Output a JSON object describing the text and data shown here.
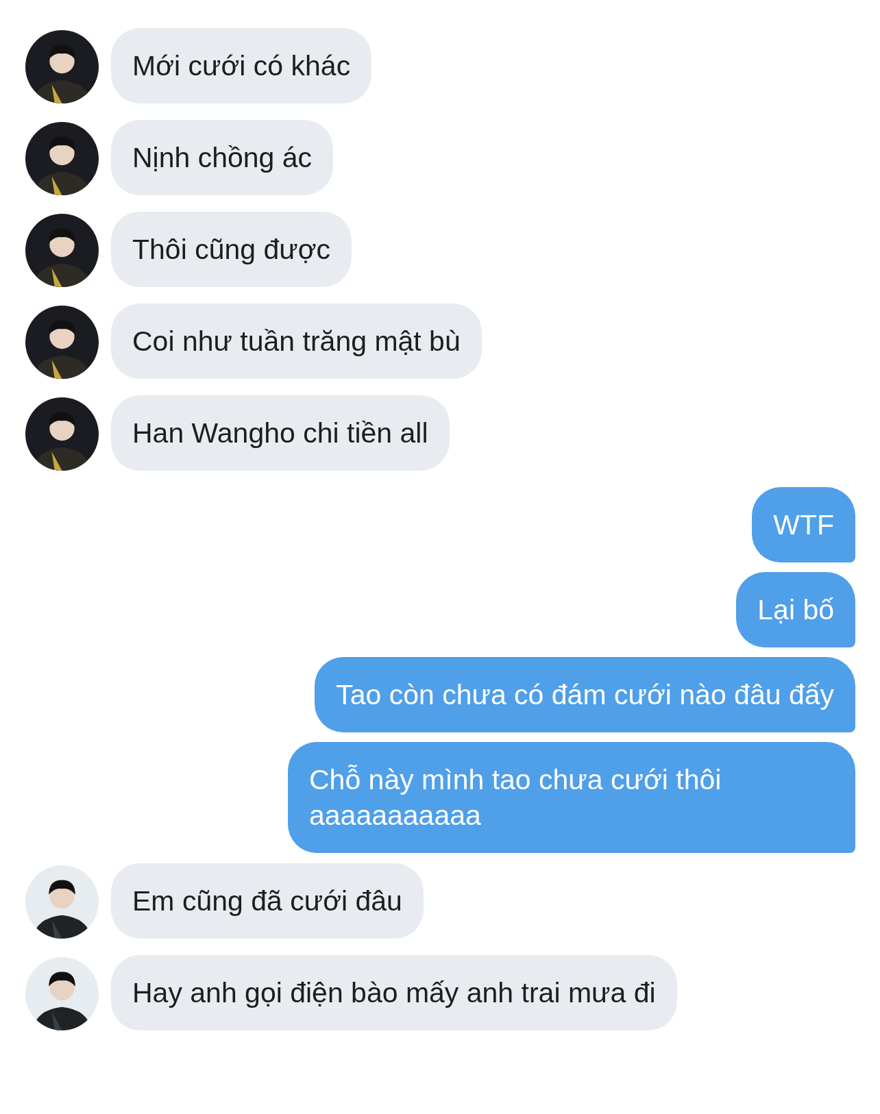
{
  "messages": [
    {
      "kind": "incoming",
      "color": "#1b1c22",
      "text": "Mới cưới có khác"
    },
    {
      "kind": "incoming",
      "color": "#1b1c22",
      "text": "Nịnh chồng ác"
    },
    {
      "kind": "incoming",
      "color": "#1b1c22",
      "text": "Thôi cũng được"
    },
    {
      "kind": "incoming",
      "color": "#1b1c22",
      "text": "Coi như tuần trăng mật bù"
    },
    {
      "kind": "incoming",
      "color": "#1b1c22",
      "text": "Han Wangho chi tiền all"
    },
    {
      "kind": "outgoing",
      "text": "WTF"
    },
    {
      "kind": "outgoing",
      "text": "Lại bố"
    },
    {
      "kind": "outgoing",
      "text": "Tao còn chưa có đám cưới nào đâu đấy"
    },
    {
      "kind": "outgoing",
      "text": "Chỗ này mình tao chưa cưới thôi aaaaaaaaaaa"
    },
    {
      "kind": "incoming",
      "color": "#e6ecef",
      "text": "Em cũng đã cưới đâu"
    },
    {
      "kind": "incoming",
      "color": "#e6ecef",
      "text": "Hay anh gọi điện bào mấy anh trai mưa đi"
    }
  ]
}
